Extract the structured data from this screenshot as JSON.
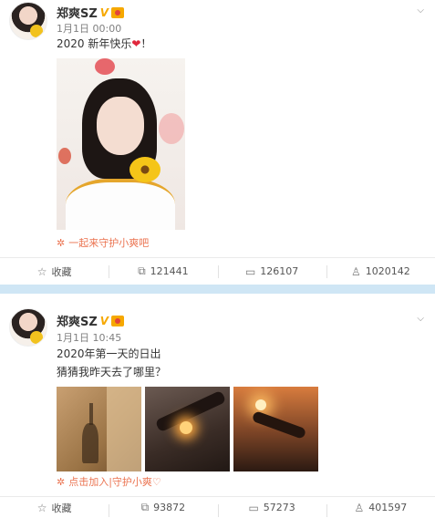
{
  "posts": [
    {
      "user_name": "郑爽SZ",
      "verified_badge": "V",
      "timestamp": "1月1日 00:00",
      "text_lines": [
        "2020 新年快乐",
        "！"
      ],
      "heart_glyph": "❤",
      "tag_text": "一起来守护小爽吧",
      "actions": {
        "favorite_label": "收藏",
        "repost_count": "121441",
        "comment_count": "126107",
        "like_count": "1020142"
      }
    },
    {
      "user_name": "郑爽SZ",
      "verified_badge": "V",
      "timestamp": "1月1日 10:45",
      "text_lines": [
        "2020年第一天的日出",
        "猜猜我昨天去了哪里？"
      ],
      "tag_text": "点击加入|守护小爽♡",
      "actions": {
        "favorite_label": "收藏",
        "repost_count": "93872",
        "comment_count": "57273",
        "like_count": "401597"
      }
    }
  ],
  "icons": {
    "favorite": "star-outline-icon",
    "repost": "share-square-icon",
    "comment": "comment-bubble-icon",
    "like": "thumbs-up-icon",
    "tag": "flower-tag-icon",
    "menu": "chevron-down-icon"
  },
  "colors": {
    "link_orange": "#eb7350",
    "verified_gold": "#f6a800",
    "separator_blue": "#cfe6f5"
  }
}
